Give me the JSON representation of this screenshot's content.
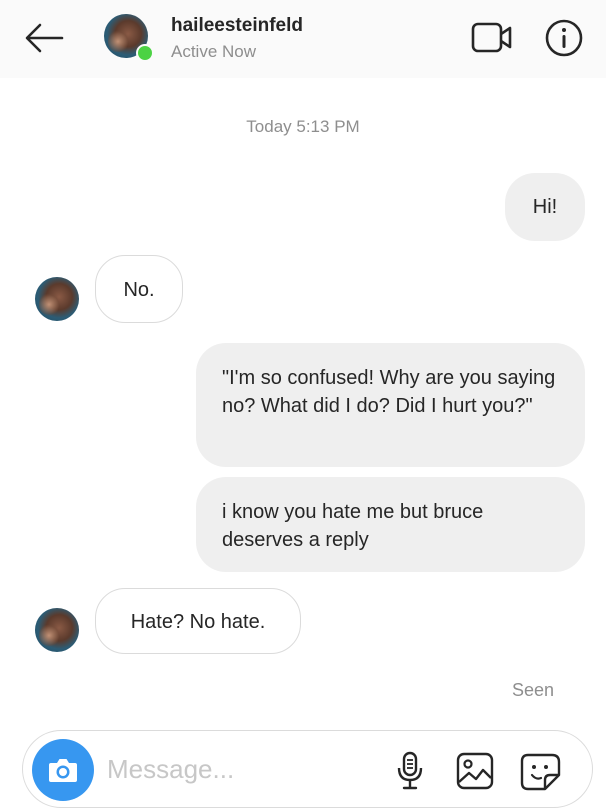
{
  "header": {
    "username": "haileesteinfeld",
    "status": "Active Now",
    "icons": {
      "back": "back-arrow-icon",
      "video": "video-call-icon",
      "info": "info-icon"
    }
  },
  "conversation": {
    "timestamp": "Today 5:13 PM",
    "messages": [
      {
        "from": "me",
        "text": "Hi!"
      },
      {
        "from": "them",
        "text": "No."
      },
      {
        "from": "me",
        "text": "\"I'm so confused! Why are you saying no? What did I do? Did I hurt you?\""
      },
      {
        "from": "me",
        "text": "i know you hate me but bruce deserves a reply"
      },
      {
        "from": "them",
        "text": "Hate? No hate."
      }
    ],
    "seen": "Seen"
  },
  "composer": {
    "placeholder": "Message...",
    "icons": {
      "camera": "camera-icon",
      "mic": "microphone-icon",
      "gallery": "gallery-icon",
      "sticker": "sticker-icon"
    }
  },
  "colors": {
    "online": "#4cd244",
    "camera_button": "#3797f0",
    "sent_bubble": "#efefef",
    "muted_text": "#8e8e8e"
  }
}
